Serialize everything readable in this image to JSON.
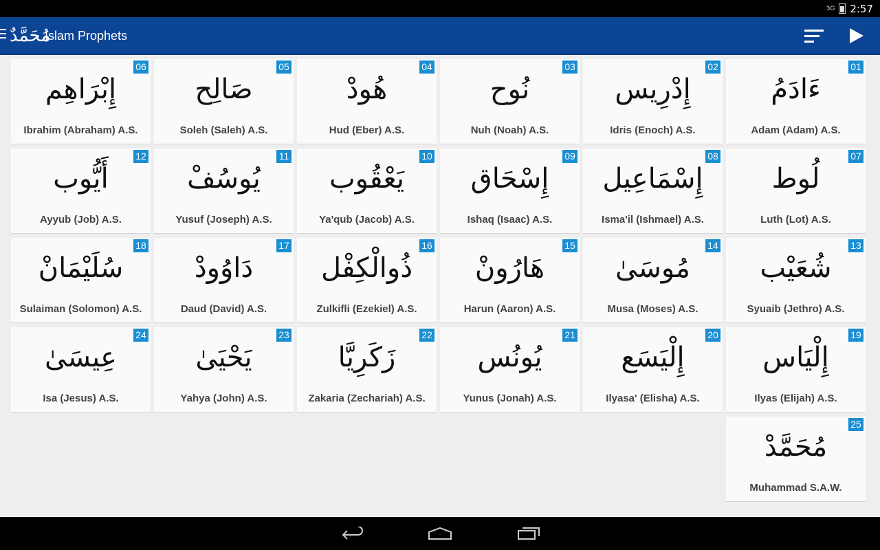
{
  "status": {
    "signal": "3G",
    "time": "2:57"
  },
  "app": {
    "title": "Islam Prophets",
    "logo_text": "مُحَمَّدٌ"
  },
  "prophets": [
    {
      "num": "01",
      "arabic": "ءَادَمُ",
      "name": "Adam (Adam) A.S."
    },
    {
      "num": "02",
      "arabic": "إِدْرِيس",
      "name": "Idris (Enoch) A.S."
    },
    {
      "num": "03",
      "arabic": "نُوح",
      "name": "Nuh (Noah) A.S."
    },
    {
      "num": "04",
      "arabic": "هُودْ",
      "name": "Hud (Eber) A.S."
    },
    {
      "num": "05",
      "arabic": "صَالِح",
      "name": "Soleh (Saleh) A.S."
    },
    {
      "num": "06",
      "arabic": "إِبْرَاهِم",
      "name": "Ibrahim (Abraham) A.S."
    },
    {
      "num": "07",
      "arabic": "لُوط",
      "name": "Luth (Lot) A.S."
    },
    {
      "num": "08",
      "arabic": "إِسْمَاعِيل",
      "name": "Isma'il (Ishmael) A.S."
    },
    {
      "num": "09",
      "arabic": "إِسْحَاق",
      "name": "Ishaq (Isaac) A.S."
    },
    {
      "num": "10",
      "arabic": "يَعْقُوب",
      "name": "Ya'qub (Jacob) A.S."
    },
    {
      "num": "11",
      "arabic": "يُوسُفْ",
      "name": "Yusuf (Joseph) A.S."
    },
    {
      "num": "12",
      "arabic": "أَيُّوب",
      "name": "Ayyub (Job) A.S."
    },
    {
      "num": "13",
      "arabic": "شُعَيْب",
      "name": "Syuaib (Jethro) A.S."
    },
    {
      "num": "14",
      "arabic": "مُوسَىٰ",
      "name": "Musa (Moses) A.S."
    },
    {
      "num": "15",
      "arabic": "هَارُونْ",
      "name": "Harun (Aaron) A.S."
    },
    {
      "num": "16",
      "arabic": "ذُوالْكِفْل",
      "name": "Zulkifli (Ezekiel) A.S."
    },
    {
      "num": "17",
      "arabic": "دَاوُودْ",
      "name": "Daud (David) A.S."
    },
    {
      "num": "18",
      "arabic": "سُلَيْمَانْ",
      "name": "Sulaiman (Solomon) A.S."
    },
    {
      "num": "19",
      "arabic": "إِلْيَاس",
      "name": "Ilyas (Elijah) A.S."
    },
    {
      "num": "20",
      "arabic": "إِلْيَسَع",
      "name": "Ilyasa' (Elisha) A.S."
    },
    {
      "num": "21",
      "arabic": "يُونُس",
      "name": "Yunus (Jonah) A.S."
    },
    {
      "num": "22",
      "arabic": "زَكَرِيَّا",
      "name": "Zakaria (Zechariah) A.S."
    },
    {
      "num": "23",
      "arabic": "يَحْيَىٰ",
      "name": "Yahya (John) A.S."
    },
    {
      "num": "24",
      "arabic": "عِيسَىٰ",
      "name": "Isa (Jesus) A.S."
    },
    {
      "num": "25",
      "arabic": "مُحَمَّدْ",
      "name": "Muhammad S.A.W."
    }
  ]
}
